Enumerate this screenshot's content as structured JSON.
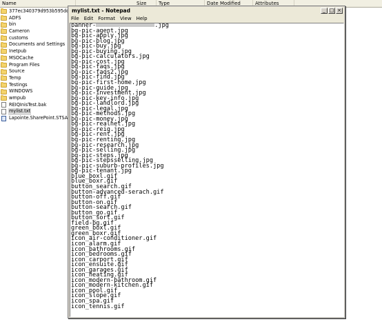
{
  "explorer": {
    "columns": [
      "Name",
      "Size",
      "Type",
      "Date Modified",
      "Attributes"
    ],
    "items": [
      {
        "name": "377ec340379d953b595dc35da",
        "icon": "folder-icon"
      },
      {
        "name": "ADFS",
        "icon": "folder-icon"
      },
      {
        "name": "bin",
        "icon": "folder-icon"
      },
      {
        "name": "Cameron",
        "icon": "folder-icon"
      },
      {
        "name": "customs",
        "icon": "folder-icon"
      },
      {
        "name": "Documents and Settings",
        "icon": "folder-icon"
      },
      {
        "name": "Inetpub",
        "icon": "folder-icon"
      },
      {
        "name": "MSOCache",
        "icon": "folder-icon"
      },
      {
        "name": "Program Files",
        "icon": "folder-icon"
      },
      {
        "name": "Source",
        "icon": "folder-icon"
      },
      {
        "name": "Temp",
        "icon": "folder-icon"
      },
      {
        "name": "Testings",
        "icon": "folder-icon"
      },
      {
        "name": "WINDOWS",
        "icon": "folder-icon"
      },
      {
        "name": "wmpub",
        "icon": "folder-icon"
      },
      {
        "name": "REIQInisTest.bak",
        "icon": "doc-icon"
      },
      {
        "name": "mylist.txt",
        "icon": "doc-icon",
        "selected": true
      },
      {
        "name": "Lapointe.SharePoint.STSADM.C",
        "icon": "doc-icon"
      }
    ]
  },
  "notepad": {
    "title": "mylist.txt - Notepad",
    "menu": [
      "File",
      "Edit",
      "Format",
      "View",
      "Help"
    ],
    "window_buttons": {
      "minimize": "_",
      "maximize": "□",
      "close": "×"
    },
    "first_line_prefix": "banner-",
    "first_line_suffix": ".jpg",
    "lines": [
      "bg-pic-agent.jpg",
      "bg-pic-apply.jpg",
      "bg-pic-blog.jpg",
      "bg-pic-buy.jpg",
      "bg-pic-buying.jpg",
      "bg-pic-calculators.jpg",
      "bg-pic-cost.jpg",
      "bg-pic-faqs.jpg",
      "bg-pic-faqs2.jpg",
      "bg-pic-find.jpg",
      "bg-pic-first-home.jpg",
      "bg-pic-guide.jpg",
      "bg-pic-investment.jpg",
      "bg-pic-key-info.jpg",
      "bg-pic-landlord.jpg",
      "bg-pic-legal.jpg",
      "bg-pic-methods.jpg",
      "bg-pic-money.jpg",
      "bg-pic-realnet.jpg",
      "bg-pic-reiq.jpg",
      "bg-pic-rent.jpg",
      "bg-pic-renting.jpg",
      "bg-pic-research.jpg",
      "bg-pic-selling.jpg",
      "bg-pic-steps.jpg",
      "bg-pic-stepsselling.jpg",
      "bg-pic-suburb-profiles.jpg",
      "bg-pic-tenant.jpg",
      "blue_boxl.gif",
      "blue_boxr.gif",
      "button_search.gif",
      "button-advanced-serach.gif",
      "button-off.gif",
      "button-on.gif",
      "button-search.gif",
      "button_go.gif",
      "button_sort.gif",
      "field-bg.gif",
      "green_boxl.gif",
      "green_boxr.gif",
      "icon_air-conditioner.gif",
      "icon_alarm.gif",
      "icon_bathrooms.gif",
      "icon_bedrooms.gif",
      "icon_carport.gif",
      "icon_ensuite.gif",
      "icon_garages.gif",
      "icon_heating.gif",
      "icon_modern-bathroom.gif",
      "icon_modern-kitchen.gif",
      "icon_pool.gif",
      "icon_slope.gif",
      "icon_spa.gif",
      "icon_tennis.gif"
    ]
  }
}
